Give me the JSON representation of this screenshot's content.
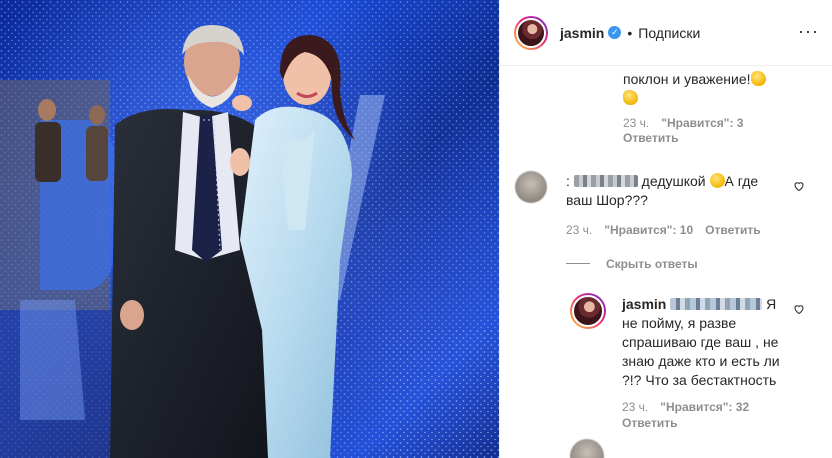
{
  "header": {
    "username": "jasmin",
    "separator": "•",
    "follow_label": "Подписки",
    "more_label": "···"
  },
  "comments": [
    {
      "text_line1": "поклон и уважение!",
      "time": "23 ч.",
      "likes": "\"Нравится\": 3",
      "reply": "Ответить"
    },
    {
      "prefix": ":",
      "text_mid": "дедушкой",
      "text_after": "А где",
      "text_line2": "ваш Шор???",
      "time": "23 ч.",
      "likes": "\"Нравится\": 10",
      "reply": "Ответить",
      "hide_replies": "Скрыть ответы"
    },
    {
      "author": "jasmin",
      "text_tail": "Я",
      "line2": "не пойму, я разве",
      "line3": "спрашиваю где ваш , не",
      "line4": "знаю даже кто и есть ли",
      "line5": "?!? Что за бестактность",
      "time": "23 ч.",
      "likes": "\"Нравится\": 32",
      "reply": "Ответить"
    }
  ],
  "colors": {
    "verified": "#3897f0",
    "meta_text": "#8e8e8e",
    "photo_backdrop": "#1a49d6"
  },
  "icons": [
    "verified-badge-icon",
    "heart-icon",
    "more-options-icon"
  ]
}
